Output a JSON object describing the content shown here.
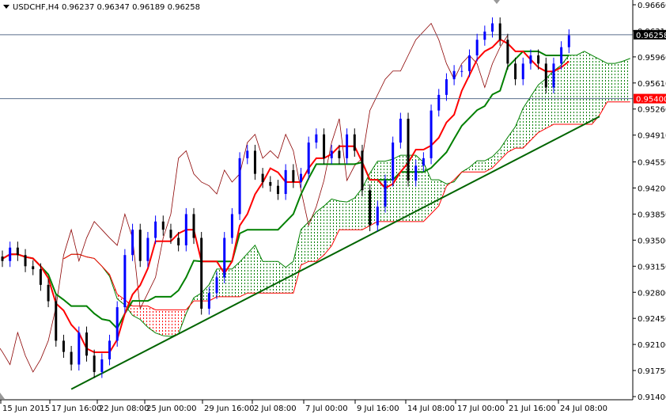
{
  "header": {
    "symbol": "USDCHF,H4",
    "ohlc": "0.96237 0.96347 0.96189 0.96258"
  },
  "price_labels": {
    "current": "0.96258",
    "level": "0.95400"
  },
  "colors": {
    "bull": "#0000ff",
    "bear": "#000000",
    "tenkan": "#ff0000",
    "kijun": "#008000",
    "chikou": "#8b0000",
    "span_a": "#008000",
    "span_b": "#ff0000",
    "trendline": "#006400",
    "level_line": "#5a6e8c",
    "current_bg": "#000000",
    "level_bg": "#ff0000"
  },
  "chart_data": {
    "type": "candlestick",
    "title": "USDCHF,H4",
    "ylim": [
      0.914,
      0.9666
    ],
    "y_ticks": [
      "0.96660",
      "0.96310",
      "0.95960",
      "0.95610",
      "0.95260",
      "0.94910",
      "0.94550",
      "0.94200",
      "0.93850",
      "0.93500",
      "0.93150",
      "0.92800",
      "0.92450",
      "0.92100",
      "0.91750",
      "0.91400"
    ],
    "x_ticks": [
      "15 Jun 2015",
      "17 Jun 16:00",
      "22 Jun 08:00",
      "25 Jun 00:00",
      "29 Jun 16:00",
      "2 Jul 08:00",
      "7 Jul 00:00",
      "9 Jul 16:00",
      "14 Jul 08:00",
      "17 Jul 00:00",
      "21 Jul 16:00",
      "24 Jul 08:00"
    ],
    "closes": [
      0.9322,
      0.934,
      0.933,
      0.9315,
      0.9311,
      0.929,
      0.9268,
      0.9215,
      0.92,
      0.9183,
      0.9226,
      0.9195,
      0.9173,
      0.919,
      0.9215,
      0.926,
      0.933,
      0.9364,
      0.9322,
      0.9353,
      0.9375,
      0.9364,
      0.9353,
      0.9343,
      0.9385,
      0.9353,
      0.9258,
      0.9279,
      0.93,
      0.9353,
      0.9385,
      0.946,
      0.947,
      0.9439,
      0.9428,
      0.9423,
      0.9412,
      0.9444,
      0.9428,
      0.9439,
      0.9481,
      0.9492,
      0.946,
      0.947,
      0.946,
      0.9492,
      0.947,
      0.9417,
      0.937,
      0.9395,
      0.943,
      0.9481,
      0.9513,
      0.943,
      0.945,
      0.946,
      0.9524,
      0.9545,
      0.9566,
      0.9577,
      0.9577,
      0.9598,
      0.9619,
      0.963,
      0.9641,
      0.9619,
      0.9587,
      0.9566,
      0.9587,
      0.9598,
      0.9587,
      0.9555,
      0.9587,
      0.9609,
      0.9625
    ],
    "indicators": {
      "type": "Ichimoku",
      "tenkan_period": 4,
      "kijun_period": 10,
      "senkou_b_period": 21,
      "displacement": 8
    },
    "trendline": {
      "from": {
        "bar": 9,
        "price": 0.915
      },
      "to": {
        "bar": 78,
        "price": 0.9516
      }
    },
    "horizontal_lines": [
      0.96258,
      0.954
    ]
  }
}
